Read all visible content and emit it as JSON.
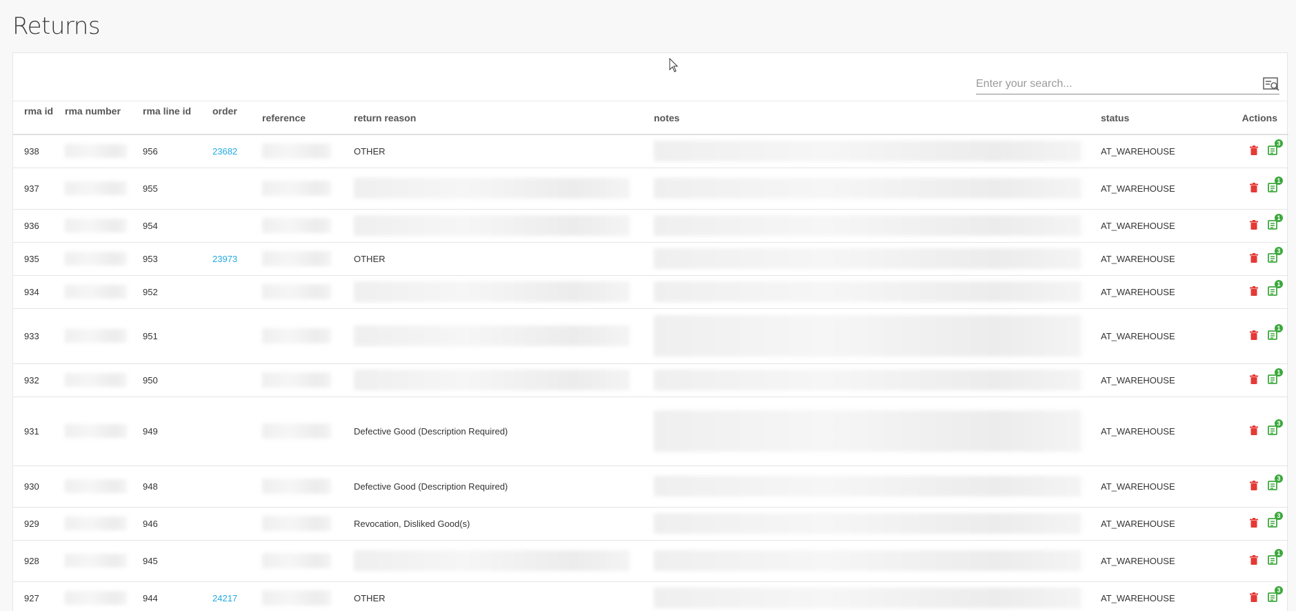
{
  "page": {
    "title": "Returns"
  },
  "search": {
    "placeholder": "Enter your search..."
  },
  "columns": {
    "rma_id": "rma id",
    "rma_number": "rma number",
    "rma_line_id": "rma line id",
    "order": "order",
    "reference": "reference",
    "return_reason": "return reason",
    "notes": "notes",
    "status": "status",
    "actions": "Actions"
  },
  "rows": [
    {
      "rma_id": "938",
      "rma_line_id": "956",
      "order": "23682",
      "return_reason": "OTHER",
      "status": "AT_WAREHOUSE",
      "badge": "3"
    },
    {
      "rma_id": "937",
      "rma_line_id": "955",
      "order": "",
      "return_reason": "",
      "status": "AT_WAREHOUSE",
      "badge": "1"
    },
    {
      "rma_id": "936",
      "rma_line_id": "954",
      "order": "",
      "return_reason": "",
      "status": "AT_WAREHOUSE",
      "badge": "1"
    },
    {
      "rma_id": "935",
      "rma_line_id": "953",
      "order": "23973",
      "return_reason": "OTHER",
      "status": "AT_WAREHOUSE",
      "badge": "3"
    },
    {
      "rma_id": "934",
      "rma_line_id": "952",
      "order": "",
      "return_reason": "",
      "status": "AT_WAREHOUSE",
      "badge": "1"
    },
    {
      "rma_id": "933",
      "rma_line_id": "951",
      "order": "",
      "return_reason": "",
      "status": "AT_WAREHOUSE",
      "badge": "1"
    },
    {
      "rma_id": "932",
      "rma_line_id": "950",
      "order": "",
      "return_reason": "",
      "status": "AT_WAREHOUSE",
      "badge": "1"
    },
    {
      "rma_id": "931",
      "rma_line_id": "949",
      "order": "",
      "return_reason": "Defective Good (Description Required)",
      "status": "AT_WAREHOUSE",
      "badge": "3"
    },
    {
      "rma_id": "930",
      "rma_line_id": "948",
      "order": "",
      "return_reason": "Defective Good (Description Required)",
      "status": "AT_WAREHOUSE",
      "badge": "3"
    },
    {
      "rma_id": "929",
      "rma_line_id": "946",
      "order": "",
      "return_reason": "Revocation, Disliked Good(s)",
      "status": "AT_WAREHOUSE",
      "badge": "3"
    },
    {
      "rma_id": "928",
      "rma_line_id": "945",
      "order": "",
      "return_reason": "",
      "status": "AT_WAREHOUSE",
      "badge": "1"
    },
    {
      "rma_id": "927",
      "rma_line_id": "944",
      "order": "24217",
      "return_reason": "OTHER",
      "status": "AT_WAREHOUSE",
      "badge": "3"
    }
  ],
  "icons": {
    "delete": "trash-icon",
    "details": "document-list-icon",
    "search": "search-list-icon"
  },
  "colors": {
    "link": "#21a9e0",
    "delete": "#e53935",
    "details": "#3ca83c"
  }
}
